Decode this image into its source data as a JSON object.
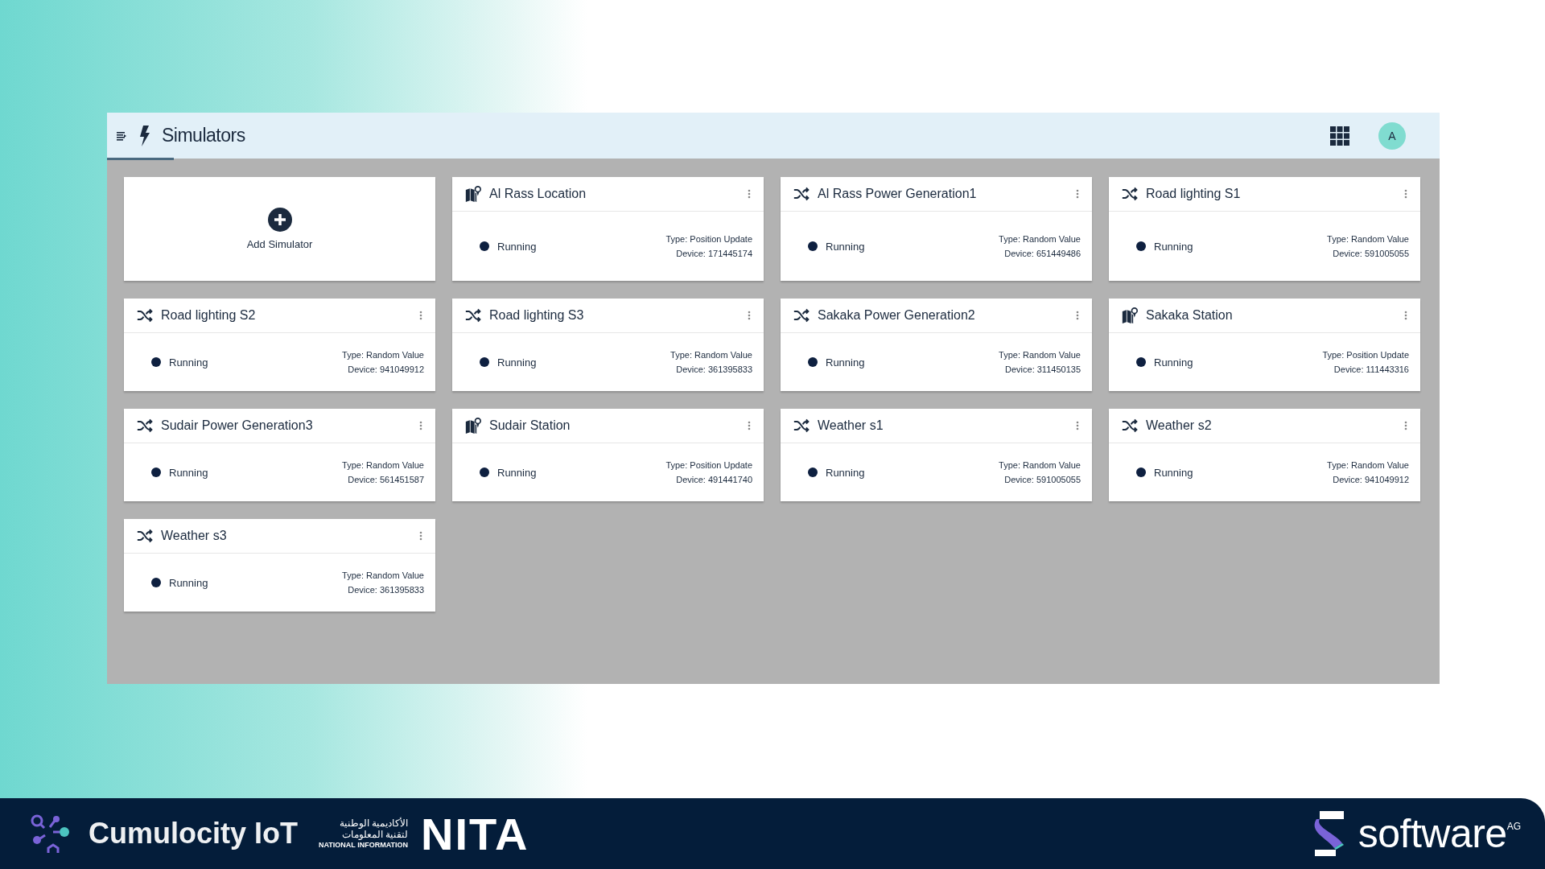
{
  "app": {
    "title": "Simulators",
    "avatar": "A"
  },
  "add_card": {
    "label": "Add Simulator"
  },
  "simulators": [
    {
      "kind": "position",
      "name": "Al Rass Location",
      "status": "Running",
      "type": "Type: Position Update",
      "device": "Device: 171445174"
    },
    {
      "kind": "random",
      "name": "Al Rass Power Generation1",
      "status": "Running",
      "type": "Type: Random Value",
      "device": "Device: 651449486"
    },
    {
      "kind": "random",
      "name": "Road lighting S1",
      "status": "Running",
      "type": "Type: Random Value",
      "device": "Device: 591005055"
    },
    {
      "kind": "random",
      "name": "Road lighting S2",
      "status": "Running",
      "type": "Type: Random Value",
      "device": "Device: 941049912"
    },
    {
      "kind": "random",
      "name": "Road lighting S3",
      "status": "Running",
      "type": "Type: Random Value",
      "device": "Device: 361395833"
    },
    {
      "kind": "random",
      "name": "Sakaka Power Generation2",
      "status": "Running",
      "type": "Type: Random Value",
      "device": "Device: 311450135"
    },
    {
      "kind": "position",
      "name": "Sakaka Station",
      "status": "Running",
      "type": "Type: Position Update",
      "device": "Device: 111443316"
    },
    {
      "kind": "random",
      "name": "Sudair Power Generation3",
      "status": "Running",
      "type": "Type: Random Value",
      "device": "Device: 561451587"
    },
    {
      "kind": "position",
      "name": "Sudair Station",
      "status": "Running",
      "type": "Type: Position Update",
      "device": "Device: 491441740"
    },
    {
      "kind": "random",
      "name": "Weather s1",
      "status": "Running",
      "type": "Type: Random Value",
      "device": "Device: 591005055"
    },
    {
      "kind": "random",
      "name": "Weather s2",
      "status": "Running",
      "type": "Type: Random Value",
      "device": "Device: 941049912"
    },
    {
      "kind": "random",
      "name": "Weather s3",
      "status": "Running",
      "type": "Type: Random Value",
      "device": "Device: 361395833"
    }
  ],
  "footer": {
    "cumulocity": "Cumulocity IoT",
    "academy_ar_1": "الأكاديمية الوطنية",
    "academy_ar_2": "لتقنية المعلومات",
    "academy_en": "NATIONAL INFORMATION",
    "nita": "NITA",
    "software": "software",
    "software_suffix": "AG"
  }
}
